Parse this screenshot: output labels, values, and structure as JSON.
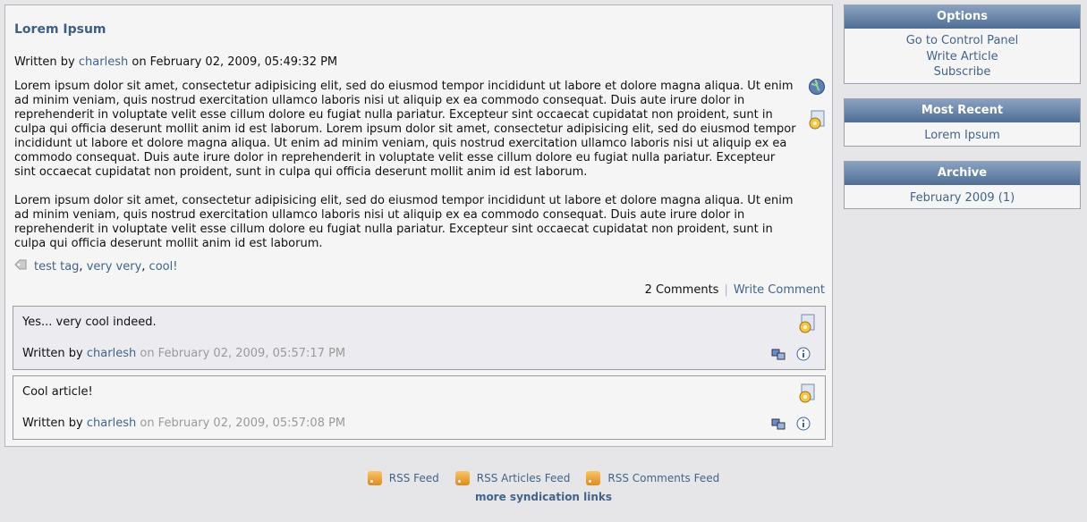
{
  "article": {
    "title": "Lorem Ipsum",
    "written_by": "Written by",
    "author": "charlesh",
    "date_text": "on February 02, 2009, 05:49:32 PM",
    "paragraph1": "Lorem ipsum dolor sit amet, consectetur adipisicing elit, sed do eiusmod tempor incididunt ut labore et dolore magna aliqua. Ut enim ad minim veniam, quis nostrud exercitation ullamco laboris nisi ut aliquip ex ea commodo consequat. Duis aute irure dolor in reprehenderit in voluptate velit esse cillum dolore eu fugiat nulla pariatur. Excepteur sint occaecat cupidatat non proident, sunt in culpa qui officia deserunt mollit anim id est laborum.  Lorem ipsum dolor sit amet, consectetur adipisicing elit, sed do eiusmod tempor incididunt ut labore et dolore magna aliqua. Ut enim ad minim veniam, quis nostrud exercitation ullamco laboris nisi ut aliquip ex ea commodo consequat. Duis aute irure dolor in reprehenderit in voluptate velit esse cillum dolore eu fugiat nulla pariatur. Excepteur sint occaecat cupidatat non proident, sunt in culpa qui officia deserunt mollit anim id est laborum.",
    "paragraph2": "Lorem ipsum dolor sit amet, consectetur adipisicing elit, sed do eiusmod tempor incididunt ut labore et dolore magna aliqua. Ut enim ad minim veniam, quis nostrud exercitation ullamco laboris nisi ut aliquip ex ea commodo consequat. Duis aute irure dolor in reprehenderit in voluptate velit esse cillum dolore eu fugiat nulla pariatur. Excepteur sint occaecat cupidatat non proident, sunt in culpa qui officia deserunt mollit anim id est laborum.",
    "tags": [
      "test tag",
      "very very",
      "cool!"
    ],
    "comments_count": "2 Comments",
    "write_comment": "Write Comment"
  },
  "comments": [
    {
      "text": "Yes... very cool indeed.",
      "written_by": "Written by",
      "author": "charlesh",
      "date_text": "on February 02, 2009, 05:57:17 PM"
    },
    {
      "text": "Cool article!",
      "written_by": "Written by",
      "author": "charlesh",
      "date_text": "on February 02, 2009, 05:57:08 PM"
    }
  ],
  "sidebar": {
    "options": {
      "title": "Options",
      "items": [
        "Go to Control Panel",
        "Write Article",
        "Subscribe"
      ]
    },
    "recent": {
      "title": "Most Recent",
      "items": [
        "Lorem Ipsum"
      ]
    },
    "archive": {
      "title": "Archive",
      "items": [
        "February 2009 (1)"
      ]
    }
  },
  "footer": {
    "feeds": [
      "RSS Feed",
      "RSS Articles Feed",
      "RSS Comments Feed"
    ],
    "more": "more syndication links"
  },
  "colors": {
    "link": "#42648a",
    "header_gradient_top": "#8aa2c0",
    "header_gradient_bottom": "#4f6e96",
    "comment_bg_1": "#ebebf0"
  }
}
